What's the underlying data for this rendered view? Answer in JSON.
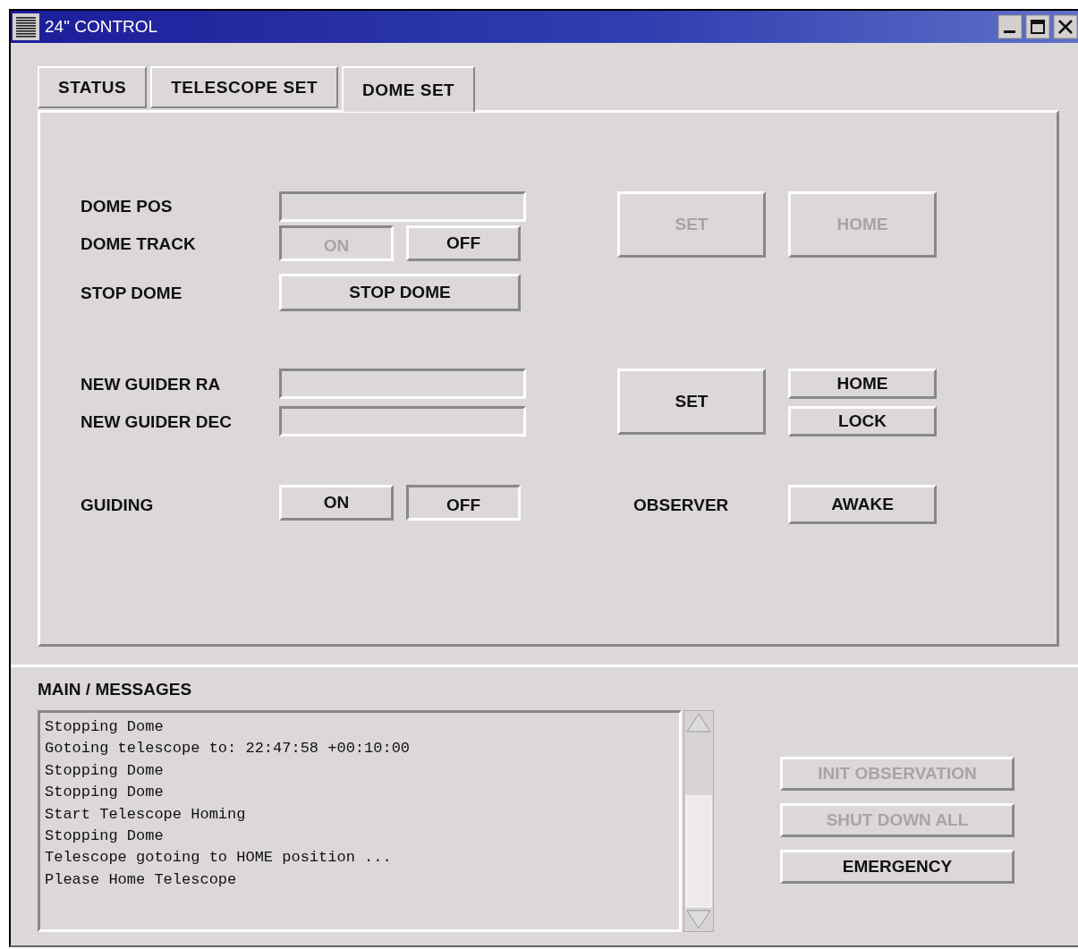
{
  "window": {
    "title": "24\" CONTROL"
  },
  "tabs": [
    {
      "label": "STATUS",
      "selected": false
    },
    {
      "label": "TELESCOPE SET",
      "selected": false
    },
    {
      "label": "DOME SET",
      "selected": true
    }
  ],
  "dome_pos": {
    "label": "DOME POS"
  },
  "dome_track": {
    "label": "DOME TRACK",
    "buttons": [
      {
        "label": "ON",
        "disabled": true,
        "pressed": true
      },
      {
        "label": "OFF",
        "disabled": false,
        "pressed": false
      }
    ]
  },
  "stop_dome": {
    "label": "STOP DOME",
    "button": {
      "label": "STOP DOME",
      "disabled": false,
      "pressed": false
    }
  },
  "dome_buttons": [
    {
      "label": "SET",
      "disabled": true,
      "pressed": false
    },
    {
      "label": "HOME",
      "disabled": true,
      "pressed": false
    }
  ],
  "guider_ra": {
    "label": "NEW GUIDER RA"
  },
  "guider_dec": {
    "label": "NEW GUIDER DEC"
  },
  "guider_set": {
    "label": "SET",
    "disabled": false,
    "pressed": false
  },
  "guider_buttons": [
    {
      "label": "HOME",
      "disabled": false,
      "pressed": false
    },
    {
      "label": "LOCK",
      "disabled": false,
      "pressed": false
    }
  ],
  "guiding": {
    "label": "GUIDING",
    "buttons": [
      {
        "label": "ON",
        "disabled": false,
        "pressed": false
      },
      {
        "label": "OFF",
        "disabled": false,
        "pressed": true
      }
    ]
  },
  "observer": {
    "label": "OBSERVER",
    "button": {
      "label": "AWAKE",
      "disabled": false,
      "pressed": false
    }
  },
  "messages": {
    "title": "MAIN / MESSAGES",
    "lines": [
      "Stopping Dome",
      "Gotoing telescope to: 22:47:58 +00:10:00",
      "Stopping Dome",
      "Stopping Dome",
      "Start Telescope Homing",
      "Stopping Dome",
      "Telescope gotoing to HOME position ...",
      "Please Home Telescope"
    ]
  },
  "actions": [
    {
      "label": "INIT OBSERVATION",
      "disabled": true,
      "pressed": false
    },
    {
      "label": "SHUT DOWN ALL",
      "disabled": true,
      "pressed": false
    },
    {
      "label": "EMERGENCY",
      "disabled": false,
      "pressed": false
    }
  ]
}
